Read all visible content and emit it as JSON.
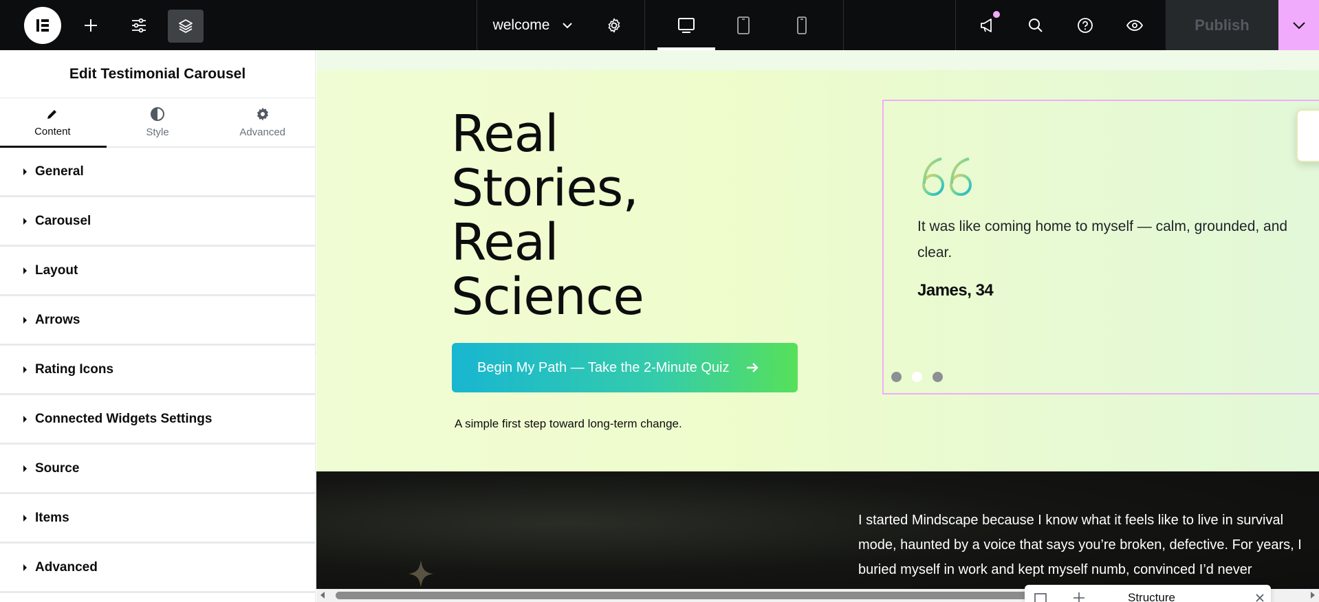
{
  "topbar": {
    "page_name": "welcome",
    "publish_label": "Publish"
  },
  "panel": {
    "title": "Edit Testimonial Carousel",
    "tabs": [
      {
        "label": "Content",
        "icon": "pencil-icon"
      },
      {
        "label": "Style",
        "icon": "half-circle-icon"
      },
      {
        "label": "Advanced",
        "icon": "gear-icon"
      }
    ],
    "sections": [
      "General",
      "Carousel",
      "Layout",
      "Arrows",
      "Rating Icons",
      "Connected Widgets Settings",
      "Source",
      "Items",
      "Advanced"
    ]
  },
  "hero": {
    "headline": [
      "Real",
      "Stories,",
      "Real",
      "Science"
    ],
    "cta_label": "Begin My Path — Take the 2-Minute Quiz",
    "cta_sub": "A simple first step toward long-term change."
  },
  "testimonial": {
    "text": "It was like coming home to myself — calm, grounded, and clear.",
    "author": "James, 34",
    "active_dot": 2,
    "dot_count": 3
  },
  "story": {
    "text": "I started Mindscape because I know what it feels like to live in survival mode, haunted by a voice that says you’re broken, defective. For years, I buried myself in work and kept myself numb, convinced I’d never"
  },
  "structure_panel": {
    "label": "Structure"
  },
  "colors": {
    "accent_pink": "#f0abfc",
    "topbar": "#0c0d0e",
    "cta_start": "#18b6d1",
    "cta_end": "#57e05a"
  }
}
